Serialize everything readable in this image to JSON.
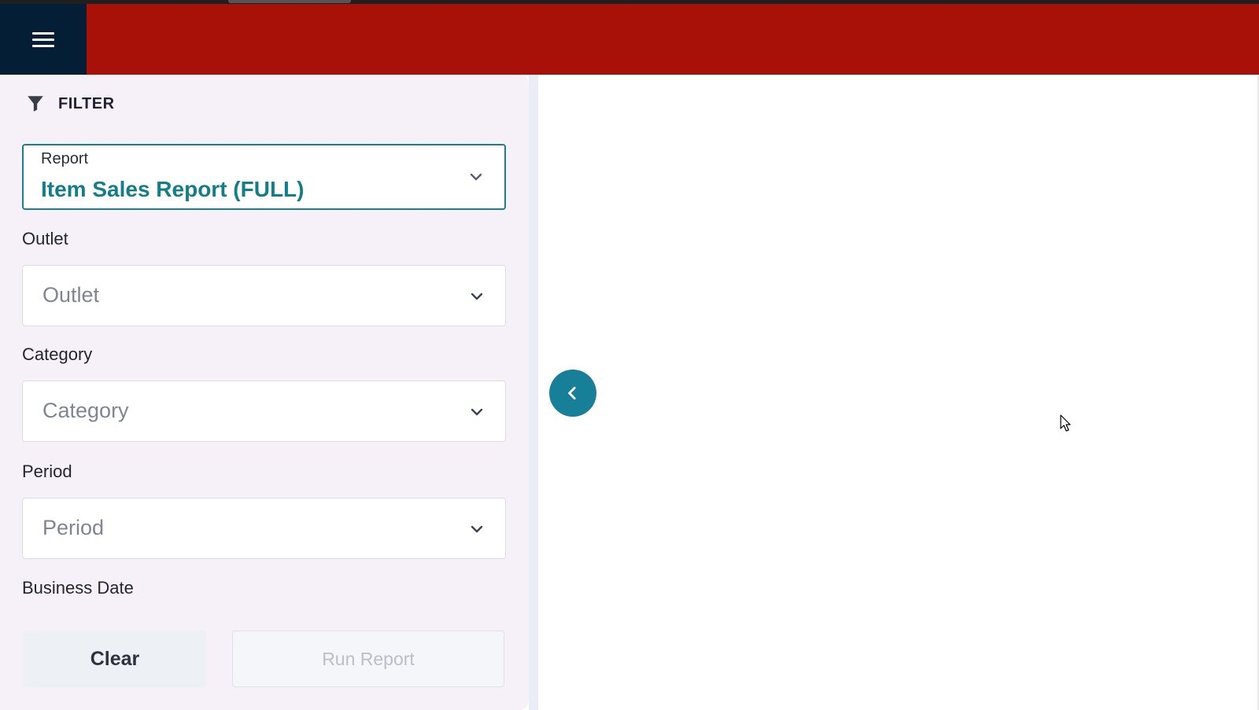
{
  "header": {
    "menu_icon": "hamburger-menu-icon",
    "brand_color": "#a81107",
    "menu_bg_color": "#041e36"
  },
  "filter": {
    "heading": "FILTER",
    "icon": "filter-funnel-icon",
    "report": {
      "label": "Report",
      "value": "Item Sales Report (FULL)"
    },
    "outlet": {
      "label": "Outlet",
      "placeholder": "Outlet"
    },
    "category": {
      "label": "Category",
      "placeholder": "Category"
    },
    "period": {
      "label": "Period",
      "placeholder": "Period"
    },
    "business_date": {
      "label": "Business Date"
    },
    "buttons": {
      "clear": "Clear",
      "run_report": "Run Report"
    }
  },
  "colors": {
    "accent": "#177f8f",
    "panel_bg": "#f6f1f8"
  },
  "collapse_button_icon": "chevron-left-icon"
}
